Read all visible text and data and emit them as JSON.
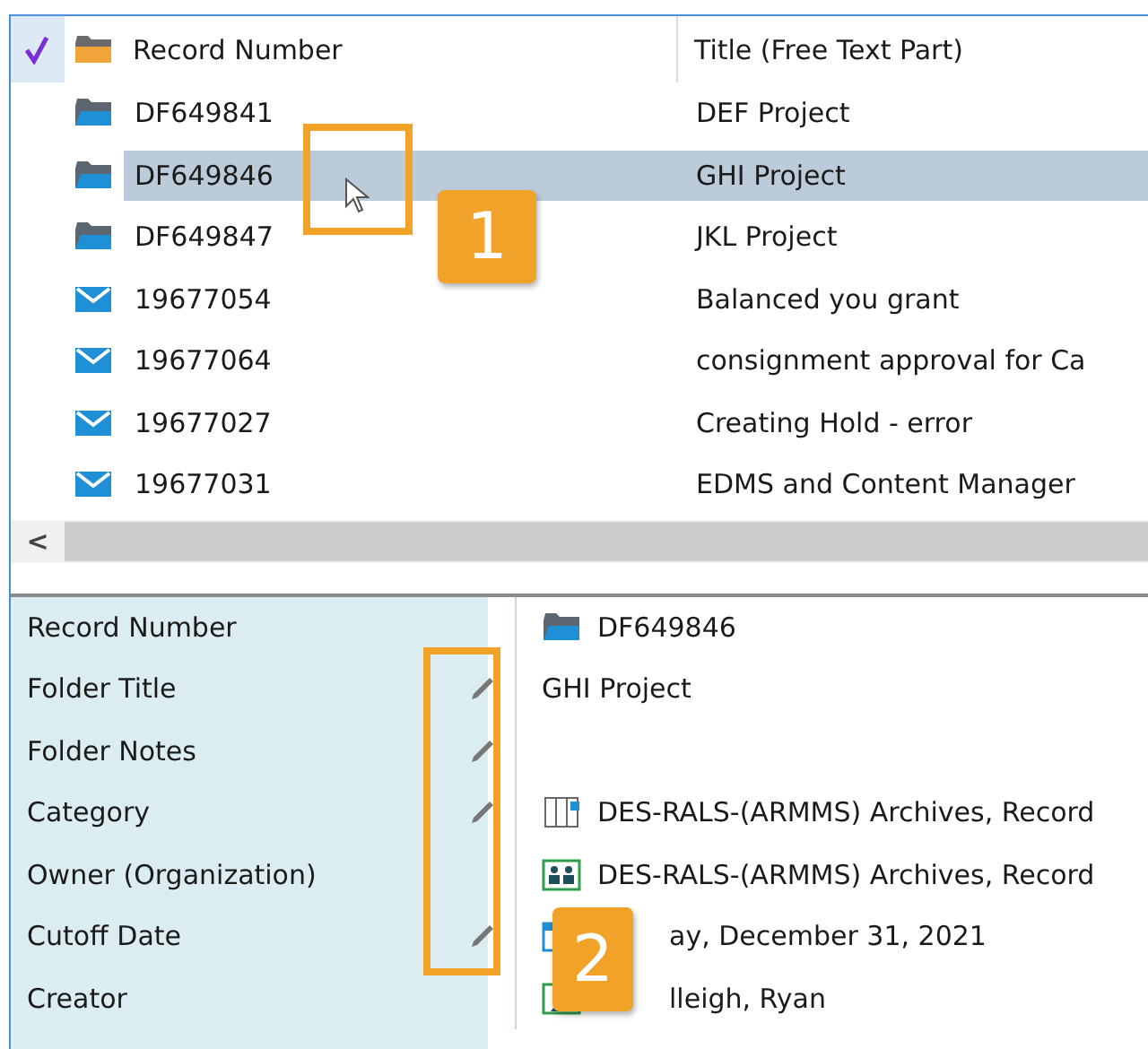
{
  "list": {
    "checked": true,
    "columns": [
      "Record Number",
      "Title (Free Text Part)"
    ],
    "rows": [
      {
        "kind": "folder",
        "number": "DF649841",
        "title": "DEF Project",
        "selected": false
      },
      {
        "kind": "folder",
        "number": "DF649846",
        "title": "GHI Project",
        "selected": true
      },
      {
        "kind": "folder",
        "number": "DF649847",
        "title": "JKL Project",
        "selected": false
      },
      {
        "kind": "email",
        "number": "19677054",
        "title": "Balanced you grant",
        "selected": false
      },
      {
        "kind": "email",
        "number": "19677064",
        "title": "consignment approval for Ca",
        "selected": false
      },
      {
        "kind": "email",
        "number": "19677027",
        "title": "Creating Hold - error",
        "selected": false
      },
      {
        "kind": "email",
        "number": "19677031",
        "title": "EDMS and Content Manager",
        "selected": false
      }
    ],
    "scroll_left": "<"
  },
  "properties": [
    {
      "label": "Record Number",
      "editable": false,
      "kind": "folder",
      "value": "DF649846"
    },
    {
      "label": "Folder Title",
      "editable": true,
      "kind": "text",
      "value": "GHI Project"
    },
    {
      "label": "Folder Notes",
      "editable": true,
      "kind": "text"
    },
    {
      "label": "Category",
      "editable": true,
      "kind": "category",
      "value": "DES-RALS-(ARMMS) Archives, Record"
    },
    {
      "label": "Owner (Organization)",
      "editable": false,
      "kind": "organization",
      "value": "DES-RALS-(ARMMS) Archives, Record"
    },
    {
      "label": "Cutoff Date",
      "editable": true,
      "kind": "calendar",
      "value": "ay, December 31, 2021"
    },
    {
      "label": "Creator",
      "editable": false,
      "kind": "person",
      "value": "lleigh, Ryan"
    }
  ],
  "callouts": [
    "1",
    "2"
  ]
}
